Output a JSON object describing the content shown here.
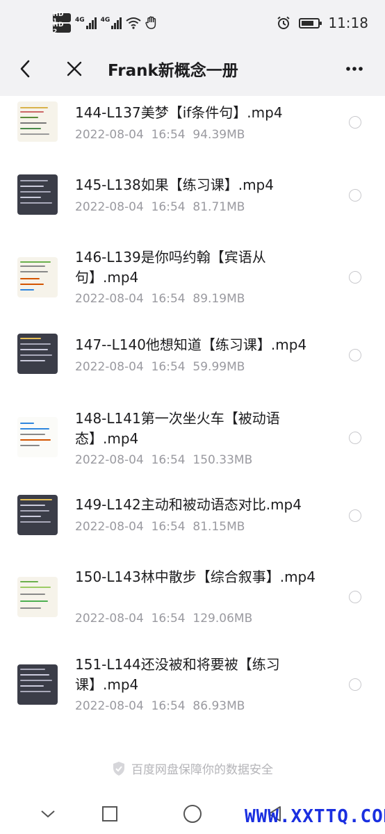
{
  "status_bar": {
    "time": "11:18",
    "hd1": "HD 1",
    "hd2": "HD 2",
    "net1": "4G",
    "net2": "4G",
    "icons": [
      "signal-icon",
      "wifi-icon",
      "hand-icon",
      "alarm-icon",
      "battery-icon"
    ],
    "battery_level": 0.75
  },
  "header": {
    "title": "Frank新概念一册",
    "icons": [
      "back-icon",
      "close-icon",
      "more-icon"
    ]
  },
  "files": [
    {
      "name": "144-L137美梦【if条件句】.mp4",
      "date": "2022-08-04",
      "time": "16:54",
      "size": "94.39MB",
      "thumb": "light"
    },
    {
      "name": "145-L138如果【练习课】.mp4",
      "date": "2022-08-04",
      "time": "16:54",
      "size": "81.71MB",
      "thumb": "dark"
    },
    {
      "name": "146-L139是你吗约翰【宾语从句】.mp4",
      "date": "2022-08-04",
      "time": "16:54",
      "size": "89.19MB",
      "thumb": "light"
    },
    {
      "name": "147--L140他想知道【练习课】.mp4",
      "date": "2022-08-04",
      "time": "16:54",
      "size": "59.99MB",
      "thumb": "dark"
    },
    {
      "name": "148-L141第一次坐火车【被动语态】.mp4",
      "date": "2022-08-04",
      "time": "16:54",
      "size": "150.33MB",
      "thumb": "light"
    },
    {
      "name": "149-L142主动和被动语态对比.mp4",
      "date": "2022-08-04",
      "time": "16:54",
      "size": "81.15MB",
      "thumb": "dark"
    },
    {
      "name": "150-L143林中散步【综合叙事】.mp4",
      "date": "2022-08-04",
      "time": "16:54",
      "size": "129.06MB",
      "thumb": "light"
    },
    {
      "name": "151-L144还没被和将要被【练习课】.mp4",
      "date": "2022-08-04",
      "time": "16:54",
      "size": "86.93MB",
      "thumb": "dark"
    }
  ],
  "footer": {
    "note": "百度网盘保障你的数据安全",
    "icon": "shield-icon"
  },
  "navbar": {
    "icons": [
      "nav-down-icon",
      "nav-recents-icon",
      "nav-home-icon",
      "nav-back-icon"
    ]
  },
  "watermark": "WWW.XXTTQ.COM"
}
